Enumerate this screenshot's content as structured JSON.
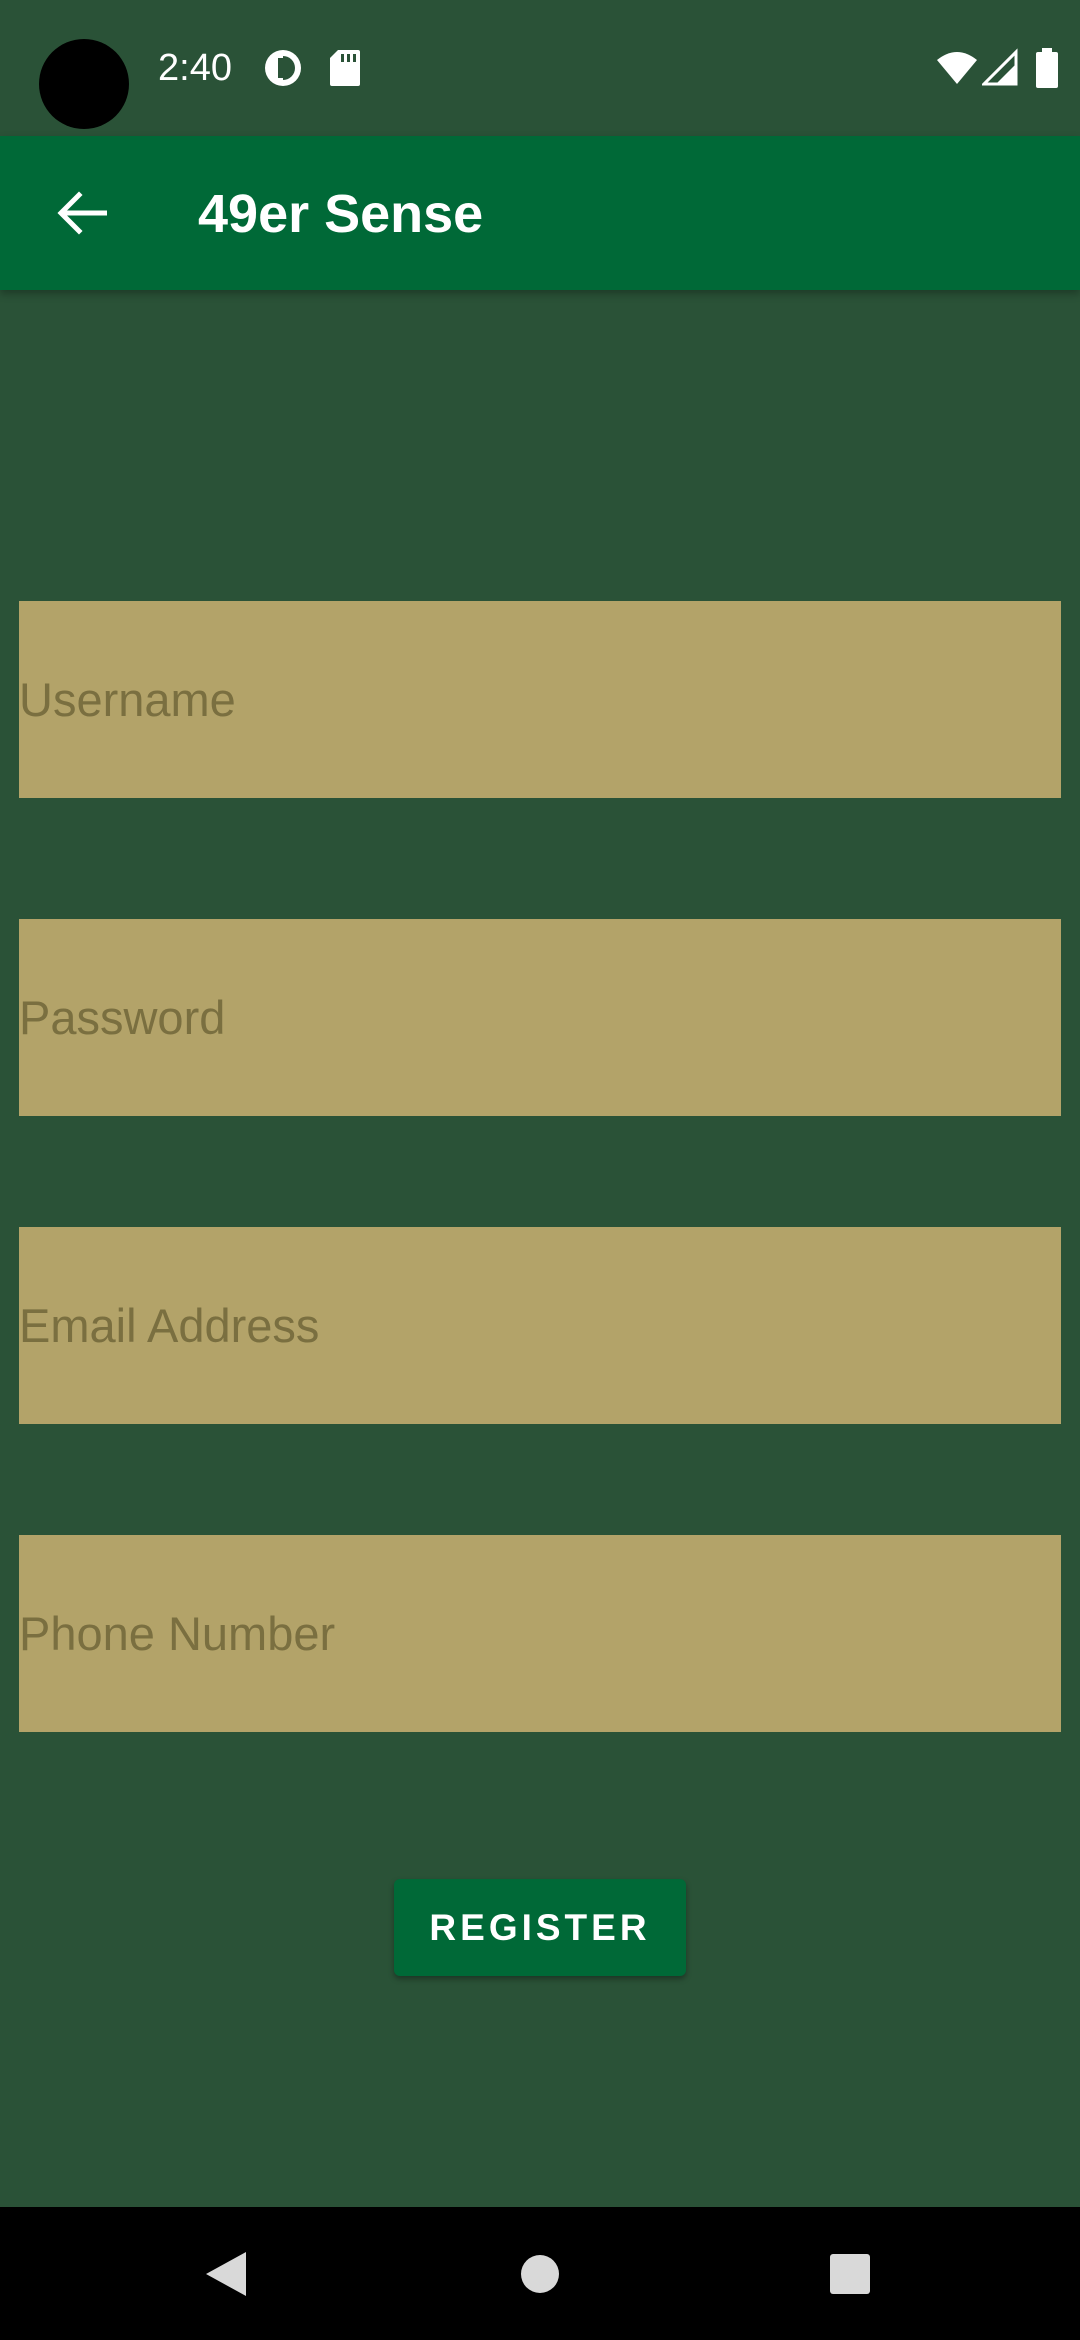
{
  "status_bar": {
    "time": "2:40",
    "icons": [
      "data-saver-icon",
      "sd-card-icon",
      "wifi-icon",
      "cell-signal-icon",
      "battery-icon"
    ]
  },
  "app_bar": {
    "back_icon": "arrow-back-icon",
    "title": "49er Sense"
  },
  "form": {
    "username": {
      "placeholder": "Username",
      "value": ""
    },
    "password": {
      "placeholder": "Password",
      "value": ""
    },
    "email": {
      "placeholder": "Email Address",
      "value": ""
    },
    "phone": {
      "placeholder": "Phone Number",
      "value": ""
    },
    "register_label": "REGISTER"
  },
  "nav_bar": {
    "back": "nav-back-icon",
    "home": "nav-home-icon",
    "recents": "nav-recents-icon"
  },
  "colors": {
    "background": "#2a5237",
    "app_bar": "#006937",
    "field": "#b3a369",
    "button": "#006937"
  }
}
